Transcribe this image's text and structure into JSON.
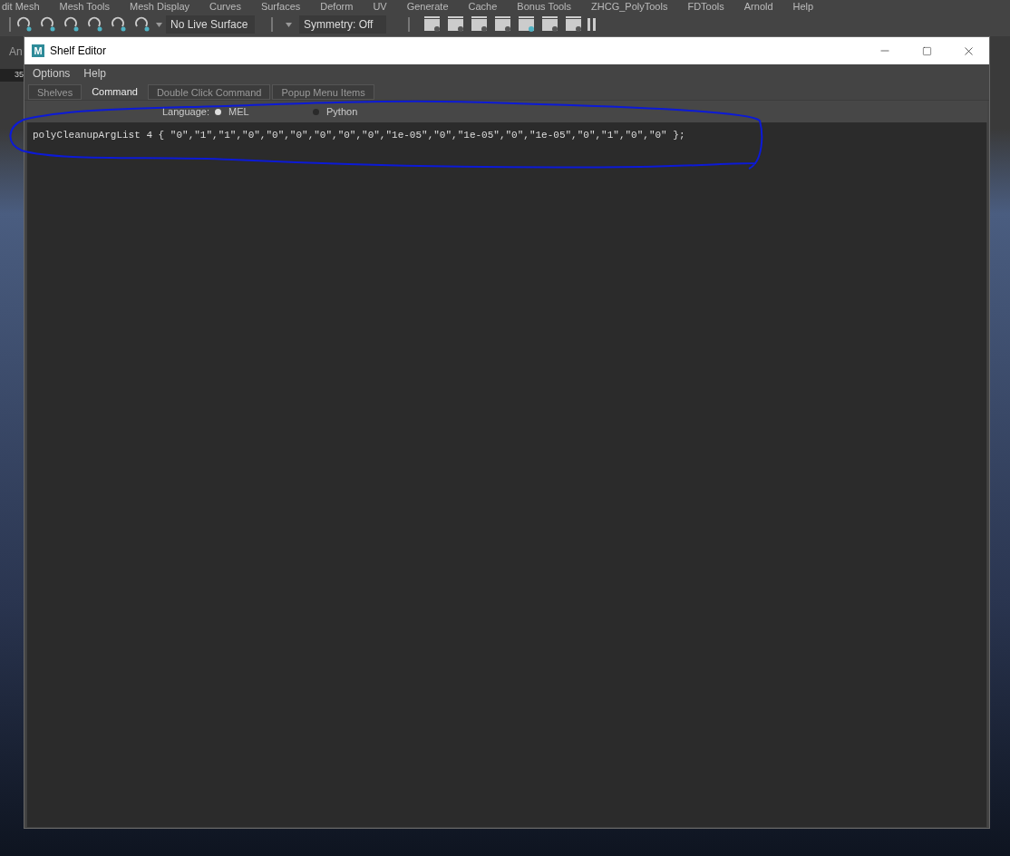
{
  "main_menu": [
    "dit Mesh",
    "Mesh Tools",
    "Mesh Display",
    "Curves",
    "Surfaces",
    "Deform",
    "UV",
    "Generate",
    "Cache",
    "Bonus Tools",
    "ZHCG_PolyTools",
    "FDTools",
    "Arnold",
    "Help"
  ],
  "toolbar": {
    "live_surface": "No Live Surface",
    "symmetry": "Symmetry: Off"
  },
  "side_tab": "An",
  "side_count": "35",
  "window": {
    "title": "Shelf Editor",
    "logo": "M"
  },
  "menu": [
    "Options",
    "Help"
  ],
  "tabs": [
    {
      "label": "Shelves",
      "selected": false
    },
    {
      "label": "Command",
      "selected": true
    },
    {
      "label": "Double Click Command",
      "selected": false
    },
    {
      "label": "Popup Menu Items",
      "selected": false
    }
  ],
  "language": {
    "label": "Language:",
    "options": [
      {
        "label": "MEL",
        "selected": true
      },
      {
        "label": "Python",
        "selected": false
      }
    ]
  },
  "command": "polyCleanupArgList 4 { \"0\",\"1\",\"1\",\"0\",\"0\",\"0\",\"0\",\"0\",\"0\",\"1e-05\",\"0\",\"1e-05\",\"0\",\"1e-05\",\"0\",\"1\",\"0\",\"0\" };"
}
